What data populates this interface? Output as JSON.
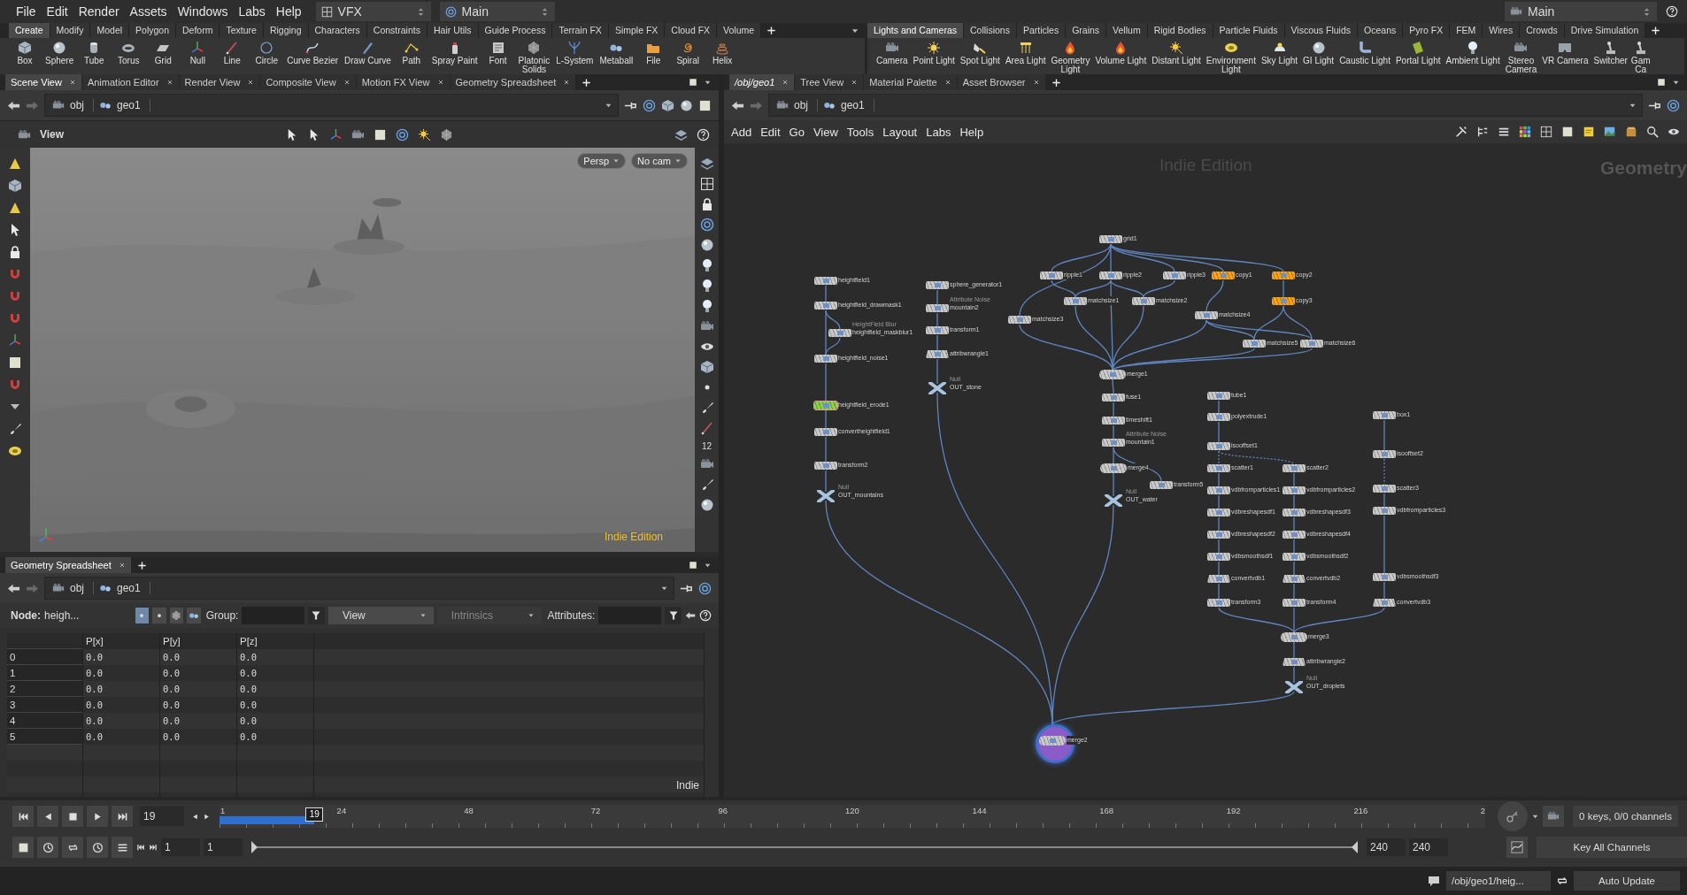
{
  "menubar": {
    "menus": [
      "File",
      "Edit",
      "Render",
      "Assets",
      "Windows",
      "Labs",
      "Help"
    ],
    "desktop": "VFX",
    "workspace": "Main",
    "right_workspace": "Main"
  },
  "shelves": [
    {
      "tabs": [
        {
          "label": "Create",
          "selected": true
        },
        {
          "label": "Modify",
          "selected": false
        },
        {
          "label": "Model",
          "selected": false
        },
        {
          "label": "Polygon",
          "selected": false
        },
        {
          "label": "Deform",
          "selected": false
        },
        {
          "label": "Texture",
          "selected": false
        },
        {
          "label": "Rigging",
          "selected": false
        },
        {
          "label": "Characters",
          "selected": false
        },
        {
          "label": "Constraints",
          "selected": false
        },
        {
          "label": "Hair Utils",
          "selected": false
        },
        {
          "label": "Guide Process",
          "selected": false
        },
        {
          "label": "Terrain FX",
          "selected": false
        },
        {
          "label": "Simple FX",
          "selected": false
        },
        {
          "label": "Cloud FX",
          "selected": false
        },
        {
          "label": "Volume",
          "selected": false
        }
      ],
      "tools": [
        "Box",
        "Sphere",
        "Tube",
        "Torus",
        "Grid",
        "Null",
        "Line",
        "Circle",
        "Curve Bezier",
        "Draw Curve",
        "Path",
        "Spray Paint",
        "Font",
        "Platonic Solids",
        "L-System",
        "Metaball",
        "File",
        "Spiral",
        "Helix"
      ]
    },
    {
      "tabs": [
        {
          "label": "Lights and Cameras",
          "selected": true
        },
        {
          "label": "Collisions",
          "selected": false
        },
        {
          "label": "Particles",
          "selected": false
        },
        {
          "label": "Grains",
          "selected": false
        },
        {
          "label": "Vellum",
          "selected": false
        },
        {
          "label": "Rigid Bodies",
          "selected": false
        },
        {
          "label": "Particle Fluids",
          "selected": false
        },
        {
          "label": "Viscous Fluids",
          "selected": false
        },
        {
          "label": "Oceans",
          "selected": false
        },
        {
          "label": "Pyro FX",
          "selected": false
        },
        {
          "label": "FEM",
          "selected": false
        },
        {
          "label": "Wires",
          "selected": false
        },
        {
          "label": "Crowds",
          "selected": false
        },
        {
          "label": "Drive Simulation",
          "selected": false
        }
      ],
      "tools": [
        "Camera",
        "Point Light",
        "Spot Light",
        "Area Light",
        "Geometry Light",
        "Volume Light",
        "Distant Light",
        "Environment Light",
        "Sky Light",
        "GI Light",
        "Caustic Light",
        "Portal Light",
        "Ambient Light",
        "Stereo Camera",
        "VR Camera",
        "Switcher",
        "Gam Ca"
      ]
    }
  ],
  "scene_pane": {
    "tabs": [
      {
        "label": "Scene View",
        "selected": true
      },
      {
        "label": "Animation Editor",
        "selected": false
      },
      {
        "label": "Render View",
        "selected": false
      },
      {
        "label": "Composite View",
        "selected": false
      },
      {
        "label": "Motion FX View",
        "selected": false
      },
      {
        "label": "Geometry Spreadsheet",
        "selected": false
      }
    ],
    "path": [
      "obj",
      "geo1"
    ],
    "viewer": {
      "title": "View",
      "projection": "Persp",
      "camera": "No cam",
      "watermark": "Indie Edition",
      "side_label": "12"
    }
  },
  "spreadsheet_pane": {
    "tabs": [
      {
        "label": "Geometry Spreadsheet",
        "selected": true
      }
    ],
    "path": [
      "obj",
      "geo1"
    ],
    "node_label": "Node:",
    "node_value": "heigh...",
    "attribute_classes": [
      {
        "kind": "points",
        "selected": true
      },
      {
        "kind": "vertices",
        "selected": false
      },
      {
        "kind": "primitives",
        "selected": false
      },
      {
        "kind": "detail",
        "selected": false
      }
    ],
    "group_label": "Group:",
    "view_menu": "View",
    "intrinsics_menu": {
      "label": "Intrinsics",
      "disabled": true
    },
    "attributes_label": "Attributes:",
    "columns": [
      "P[x]",
      "P[y]",
      "P[z]"
    ],
    "rows": [
      {
        "index": "0",
        "values": [
          "0.0",
          "0.0",
          "0.0"
        ]
      },
      {
        "index": "1",
        "values": [
          "0.0",
          "0.0",
          "0.0"
        ]
      },
      {
        "index": "2",
        "values": [
          "0.0",
          "0.0",
          "0.0"
        ]
      },
      {
        "index": "3",
        "values": [
          "0.0",
          "0.0",
          "0.0"
        ]
      },
      {
        "index": "4",
        "values": [
          "0.0",
          "0.0",
          "0.0"
        ]
      },
      {
        "index": "5",
        "values": [
          "0.0",
          "0.0",
          "0.0"
        ]
      }
    ],
    "footer": "Indie"
  },
  "network_pane": {
    "tabs": [
      {
        "label": "/obj/geo1",
        "selected": true
      },
      {
        "label": "Tree View",
        "selected": false
      },
      {
        "label": "Material Palette",
        "selected": false
      },
      {
        "label": "Asset Browser",
        "selected": false
      }
    ],
    "path": [
      "obj",
      "geo1"
    ],
    "menus": [
      "Add",
      "Edit",
      "Go",
      "View",
      "Tools",
      "Layout",
      "Labs",
      "Help"
    ],
    "watermark": "Indie Edition",
    "context_label": "Geometry",
    "nodes": [
      {
        "name": "heightfield1",
        "kind": "sop",
        "selected": false,
        "display": false
      },
      {
        "name": "heightfield_drawmask1",
        "kind": "sop",
        "selected": false,
        "display": false
      },
      {
        "name": "heightfield_maskblur1",
        "kind": "sop",
        "type_label": "HeightField Blur",
        "selected": false,
        "display": false
      },
      {
        "name": "heightfield_noise1",
        "kind": "sop",
        "selected": false,
        "display": false
      },
      {
        "name": "heightfield_erode1",
        "kind": "sop",
        "selected": true,
        "display": false
      },
      {
        "name": "convertheightfield1",
        "kind": "sop",
        "selected": false,
        "display": false
      },
      {
        "name": "transform2",
        "kind": "sop",
        "selected": false,
        "display": false
      },
      {
        "name": "OUT_mountains",
        "kind": "null",
        "type_label": "Null",
        "selected": false,
        "display": false
      },
      {
        "name": "sphere_generator1",
        "kind": "sop",
        "selected": false,
        "display": false
      },
      {
        "name": "mountain2",
        "kind": "sop",
        "type_label": "Attribute Noise",
        "selected": false,
        "display": false
      },
      {
        "name": "transform1",
        "kind": "sop",
        "selected": false,
        "display": false
      },
      {
        "name": "attribwrangle1",
        "kind": "multi",
        "selected": false,
        "display": false
      },
      {
        "name": "OUT_stone",
        "kind": "null",
        "type_label": "Null",
        "selected": false,
        "display": false
      },
      {
        "name": "grid1",
        "kind": "sop",
        "selected": false,
        "display": false
      },
      {
        "name": "ripple1",
        "kind": "sop",
        "selected": false,
        "display": false
      },
      {
        "name": "ripple2",
        "kind": "sop",
        "selected": false,
        "display": false
      },
      {
        "name": "ripple3",
        "kind": "sop",
        "selected": false,
        "display": false
      },
      {
        "name": "copy1",
        "kind": "sop",
        "color": "#f5a31a",
        "selected": false,
        "display": false
      },
      {
        "name": "copy2",
        "kind": "sop",
        "color": "#f5a31a",
        "selected": false,
        "display": false
      },
      {
        "name": "matchsize1",
        "kind": "sop",
        "selected": false,
        "display": false
      },
      {
        "name": "matchsize2",
        "kind": "sop",
        "selected": false,
        "display": false
      },
      {
        "name": "copy3",
        "kind": "sop",
        "color": "#f5a31a",
        "selected": false,
        "display": false
      },
      {
        "name": "matchsize3",
        "kind": "sop",
        "selected": false,
        "display": false
      },
      {
        "name": "matchsize4",
        "kind": "sop",
        "selected": false,
        "display": false
      },
      {
        "name": "matchsize5",
        "kind": "sop",
        "selected": false,
        "display": false
      },
      {
        "name": "matchsize6",
        "kind": "sop",
        "selected": false,
        "display": false
      },
      {
        "name": "merge1",
        "kind": "merge",
        "selected": false,
        "display": false
      },
      {
        "name": "fuse1",
        "kind": "sop",
        "selected": false,
        "display": false
      },
      {
        "name": "timeshift1",
        "kind": "sop",
        "selected": false,
        "display": false
      },
      {
        "name": "mountain1",
        "kind": "sop",
        "type_label": "Attribute Noise",
        "selected": false,
        "display": false
      },
      {
        "name": "merge4",
        "kind": "merge",
        "selected": false,
        "display": false
      },
      {
        "name": "transform5",
        "kind": "sop",
        "selected": false,
        "display": false
      },
      {
        "name": "OUT_water",
        "kind": "null",
        "type_label": "Null",
        "selected": false,
        "display": false
      },
      {
        "name": "tube1",
        "kind": "sop",
        "selected": false,
        "display": false
      },
      {
        "name": "polyextrude1",
        "kind": "sop",
        "selected": false,
        "display": false
      },
      {
        "name": "isooffset1",
        "kind": "sop",
        "selected": false,
        "display": false
      },
      {
        "name": "box1",
        "kind": "sop",
        "selected": false,
        "display": false
      },
      {
        "name": "isooffset2",
        "kind": "sop",
        "selected": false,
        "display": false
      },
      {
        "name": "scatter1",
        "kind": "sop",
        "selected": false,
        "display": false
      },
      {
        "name": "scatter2",
        "kind": "sop",
        "selected": false,
        "display": false
      },
      {
        "name": "vdbfromparticles1",
        "kind": "sop",
        "selected": false,
        "display": false
      },
      {
        "name": "vdbfromparticles2",
        "kind": "sop",
        "selected": false,
        "display": false
      },
      {
        "name": "scatter3",
        "kind": "sop",
        "selected": false,
        "display": false
      },
      {
        "name": "vdbreshapesdf1",
        "kind": "sop",
        "selected": false,
        "display": false
      },
      {
        "name": "vdbreshapesdf3",
        "kind": "sop",
        "selected": false,
        "display": false
      },
      {
        "name": "vdbfromparticles3",
        "kind": "sop",
        "selected": false,
        "display": false
      },
      {
        "name": "vdbreshapesdf2",
        "kind": "sop",
        "selected": false,
        "display": false
      },
      {
        "name": "vdbreshapesdf4",
        "kind": "sop",
        "selected": false,
        "display": false
      },
      {
        "name": "vdbsmoothsdf1",
        "kind": "sop",
        "selected": false,
        "display": false
      },
      {
        "name": "vdbsmoothsdf2",
        "kind": "sop",
        "selected": false,
        "display": false
      },
      {
        "name": "convertvdb1",
        "kind": "multi",
        "selected": false,
        "display": false
      },
      {
        "name": "convertvdb2",
        "kind": "multi",
        "selected": false,
        "display": false
      },
      {
        "name": "vdbsmoothsdf3",
        "kind": "sop",
        "selected": false,
        "display": false
      },
      {
        "name": "transform3",
        "kind": "sop",
        "selected": false,
        "display": false
      },
      {
        "name": "transform4",
        "kind": "sop",
        "selected": false,
        "display": false
      },
      {
        "name": "convertvdb3",
        "kind": "multi",
        "selected": false,
        "display": false
      },
      {
        "name": "merge3",
        "kind": "merge",
        "selected": false,
        "display": false
      },
      {
        "name": "attribwrangle2",
        "kind": "multi",
        "selected": false,
        "display": false
      },
      {
        "name": "OUT_droplets",
        "kind": "null",
        "type_label": "Null",
        "selected": false,
        "display": false
      },
      {
        "name": "merge2",
        "kind": "merge",
        "selected": false,
        "display": true
      }
    ]
  },
  "timeline": {
    "frame": "19",
    "current_frame": "19",
    "level": 0.075,
    "ticks": [
      "1",
      "24",
      "48",
      "72",
      "96",
      "120",
      "144",
      "168",
      "192",
      "216",
      "2"
    ],
    "range_start": "1",
    "range_start_2": "1",
    "range_end": "240",
    "range_end_2": "240",
    "range_slider": {
      "level": 1
    },
    "keys_info": "0 keys, 0/0 channels",
    "key_button": "Key All Channels"
  },
  "status_bar": {
    "path": "/obj/geo1/heig...",
    "update_mode": "Auto Update"
  }
}
